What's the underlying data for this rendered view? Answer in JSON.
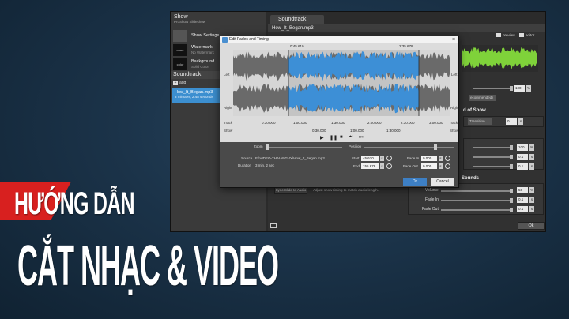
{
  "sidebar": {
    "title": "Show",
    "subtitle": "ProShow Slideshow",
    "items": [
      {
        "label": "Show Settings",
        "sub": "",
        "thumb": ""
      },
      {
        "label": "Watermark",
        "sub": "No Watermark",
        "thumb": "none"
      },
      {
        "label": "Background",
        "sub": "Solid Color",
        "thumb": "color"
      }
    ],
    "section": "Soundtrack",
    "add_label": "add",
    "track": {
      "name": "How_It_Began.mp3",
      "info": "3 minutes, 2.48 seconds"
    }
  },
  "main": {
    "tab": "Soundtrack",
    "track_name": "How_It_Began.mp3",
    "preview_label": "preview",
    "editor_label": "editor",
    "volume_value": "100",
    "pct": "%",
    "recommended_dd": "ecommended)",
    "end_of_show_label": "d of Show",
    "transition_dd": "Transition",
    "transition_value": "0",
    "unit_s": "s",
    "slide_vals": [
      {
        "value": "100",
        "unit": "%"
      },
      {
        "value": "0.1",
        "unit": "s"
      },
      {
        "value": "0.1",
        "unit": "s"
      }
    ],
    "sounds_header": "Sounds",
    "sound_rows": [
      {
        "label": "Volume",
        "value": "50",
        "unit": "%"
      },
      {
        "label": "Fade In",
        "value": "0.1",
        "unit": "s"
      },
      {
        "label": "Fade Out",
        "value": "0.1",
        "unit": "s"
      }
    ],
    "sync_button": "Sync Slide to Audio",
    "sync_desc": "Adjust show timing to match audio length.",
    "ok_button": "Ok"
  },
  "dialog": {
    "title": "Edit Fades and Timing",
    "close": "×",
    "left_label": "Left",
    "right_label": "Right",
    "track_label": "Track",
    "show_label": "Show",
    "marker_start": "0:45.610",
    "marker_end": "2:35.678",
    "time_ticks": [
      "0:30.000",
      "1:00.000",
      "1:30.000",
      "2:00.000",
      "2:30.000",
      "3:00.000"
    ],
    "show_ticks": [
      "0:30.000",
      "1:00.000",
      "1:30.000"
    ],
    "zoom_label": "Zoom",
    "position_label": "Position",
    "source_label": "Source",
    "source_value": "E:\\VIDEO-THAIANGVY\\How_It_Began.mp3",
    "duration_label": "Duration",
    "duration_value": "3 min, 2 sec",
    "start_label": "Start",
    "start_value": "45.610",
    "end_label": "End",
    "end_value": "155.678",
    "fade_in_label": "Fade In",
    "fade_in_value": "0.000",
    "fade_out_label": "Fade Out",
    "fade_out_value": "0.000",
    "unit_s": "s",
    "ok": "Ok",
    "cancel": "Cancel"
  },
  "banner": {
    "line1": "HƯỚNG DẪN",
    "line2": "CẮT NHẠC & VIDEO"
  },
  "colors": {
    "accent_blue": "#3d8fd6",
    "banner_red": "#d8201f",
    "wave_green": "#7fd23a"
  }
}
